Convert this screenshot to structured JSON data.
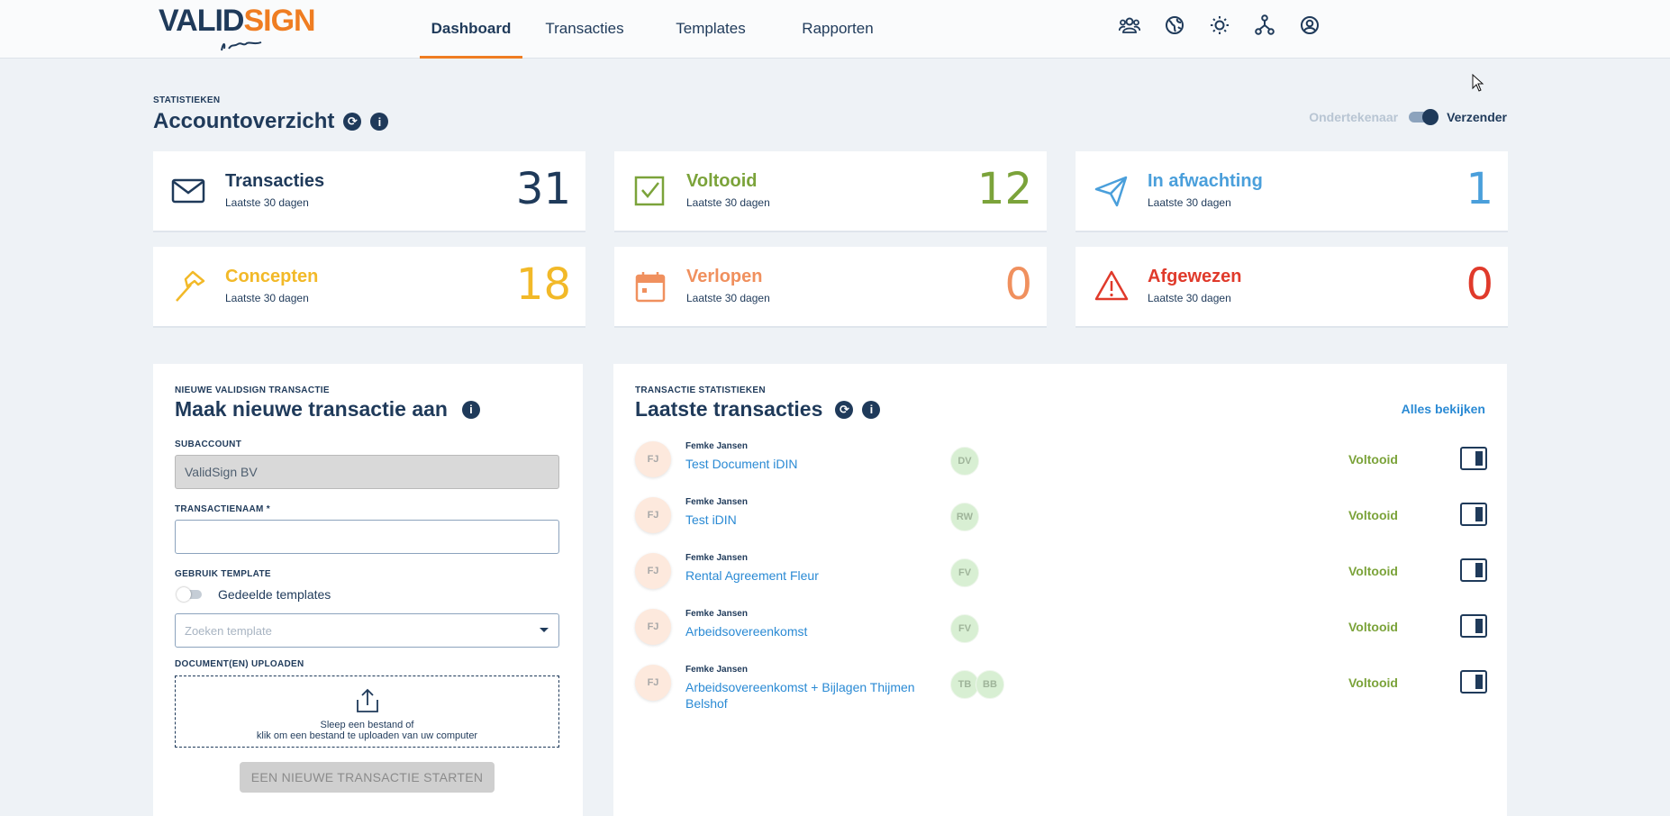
{
  "brand": {
    "name_part1": "VALID",
    "name_part2": "SIGN"
  },
  "nav": [
    "Dashboard",
    "Transacties",
    "Templates",
    "Rapporten"
  ],
  "top_icons": [
    "users-icon",
    "globe-icon",
    "sun-icon",
    "network-icon",
    "user-circle-icon"
  ],
  "stats_header": {
    "eyebrow": "STATISTIEKEN",
    "title": "Accountoverzicht",
    "toggle_left": "Ondertekenaar",
    "toggle_right": "Verzender"
  },
  "stats": [
    {
      "title": "Transacties",
      "sub": "Laatste 30 dagen",
      "value": "31",
      "color": "#1f3a5a",
      "icon": "envelope-icon"
    },
    {
      "title": "Voltooid",
      "sub": "Laatste 30 dagen",
      "value": "12",
      "color": "#7ba33a",
      "icon": "check-square-icon"
    },
    {
      "title": "In afwachting",
      "sub": "Laatste 30 dagen",
      "value": "1",
      "color": "#4a9fdb",
      "icon": "paper-plane-icon"
    },
    {
      "title": "Concepten",
      "sub": "Laatste 30 dagen",
      "value": "18",
      "color": "#f2b928",
      "icon": "hammer-icon"
    },
    {
      "title": "Verlopen",
      "sub": "Laatste 30 dagen",
      "value": "0",
      "color": "#f0905e",
      "icon": "calendar-icon"
    },
    {
      "title": "Afgewezen",
      "sub": "Laatste 30 dagen",
      "value": "0",
      "color": "#e03a2b",
      "icon": "warning-icon"
    }
  ],
  "new_tx": {
    "eyebrow": "NIEUWE VALIDSIGN TRANSACTIE",
    "title": "Maak nieuwe transactie aan",
    "subaccount_label": "SUBACCOUNT",
    "subaccount_value": "ValidSign BV",
    "name_label": "TRANSACTIENAAM *",
    "name_value": "",
    "template_label": "GEBRUIK TEMPLATE",
    "shared_templates": "Gedeelde templates",
    "template_placeholder": "Zoeken template",
    "upload_label": "DOCUMENT(EN) UPLOADEN",
    "upload_line1": "Sleep een bestand of",
    "upload_line2": "klik om een bestand te uploaden van uw computer",
    "start_button": "EEN NIEUWE TRANSACTIE STARTEN"
  },
  "latest": {
    "eyebrow": "TRANSACTIE STATISTIEKEN",
    "title": "Laatste transacties",
    "view_all": "Alles bekijken",
    "rows": [
      {
        "avatar": "FJ",
        "owner": "Femke Jansen",
        "name": "Test Document iDIN",
        "signers": [
          "DV"
        ],
        "status": "Voltooid"
      },
      {
        "avatar": "FJ",
        "owner": "Femke Jansen",
        "name": "Test iDIN",
        "signers": [
          "RW"
        ],
        "status": "Voltooid"
      },
      {
        "avatar": "FJ",
        "owner": "Femke Jansen",
        "name": "Rental Agreement Fleur",
        "signers": [
          "FV"
        ],
        "status": "Voltooid"
      },
      {
        "avatar": "FJ",
        "owner": "Femke Jansen",
        "name": "Arbeidsovereenkomst",
        "signers": [
          "FV"
        ],
        "status": "Voltooid"
      },
      {
        "avatar": "FJ",
        "owner": "Femke Jansen",
        "name": "Arbeidsovereenkomst + Bijlagen Thijmen Belshof",
        "signers": [
          "TB",
          "BB"
        ],
        "status": "Voltooid"
      }
    ]
  }
}
